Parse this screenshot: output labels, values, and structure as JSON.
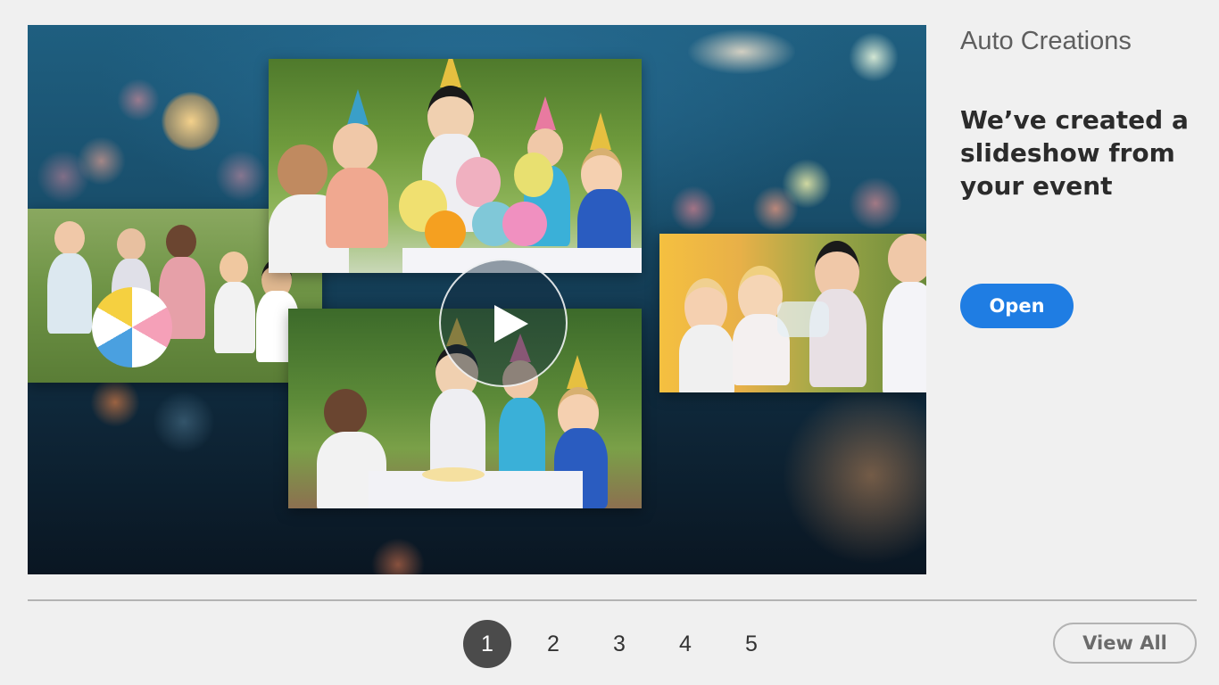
{
  "panel": {
    "section_title": "Auto Creations",
    "headline": "We’ve created a slideshow from your event",
    "open_label": "Open"
  },
  "pagination": {
    "pages": [
      "1",
      "2",
      "3",
      "4",
      "5"
    ],
    "active_page": "1"
  },
  "footer": {
    "view_all_label": "View All"
  },
  "preview": {
    "play_icon": "play-icon"
  },
  "colors": {
    "accent": "#1f7de3",
    "active_page": "#4b4b4b",
    "divider": "#b3b3b3"
  }
}
